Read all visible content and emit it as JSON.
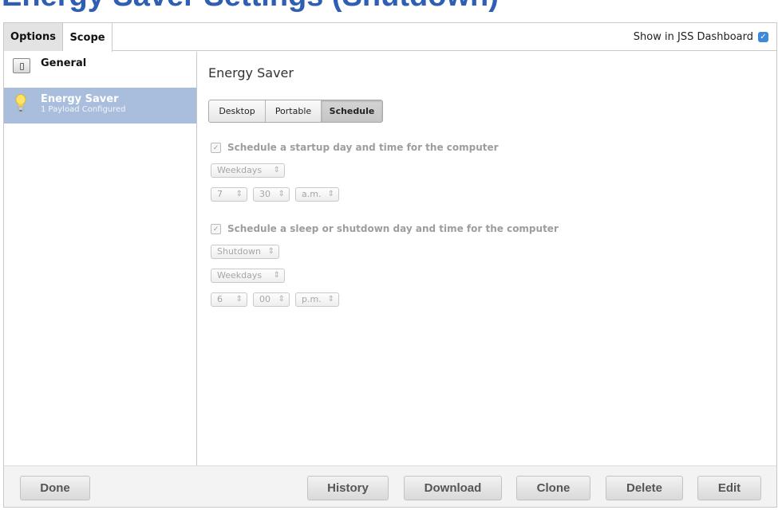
{
  "page": {
    "title": "Energy Saver Settings (Shutdown)"
  },
  "colors": {
    "accent": "#3c8ad9",
    "title": "#2f5fb3",
    "selected_row": "#a8bedc"
  },
  "tabs": {
    "options": "Options",
    "scope": "Scope"
  },
  "dashboard": {
    "label": "Show in JSS Dashboard",
    "checked": true
  },
  "sidebar": {
    "items": [
      {
        "label": "General",
        "icon": "general-switch-icon"
      },
      {
        "label": "Energy Saver",
        "sublabel": "1 Payload Configured",
        "icon": "lightbulb-icon",
        "selected": true
      }
    ]
  },
  "main": {
    "title": "Energy Saver",
    "segments": [
      "Desktop",
      "Portable",
      "Schedule"
    ],
    "active_segment": "Schedule",
    "startup": {
      "label": "Schedule a startup day and time for the computer",
      "checked": true,
      "days": "Weekdays",
      "hour": "7",
      "minute": "30",
      "ampm": "a.m."
    },
    "sleep": {
      "label": "Schedule a sleep or shutdown day and time for the computer",
      "checked": true,
      "action": "Shutdown",
      "days": "Weekdays",
      "hour": "6",
      "minute": "00",
      "ampm": "p.m."
    }
  },
  "footer": {
    "done": "Done",
    "history": "History",
    "download": "Download",
    "clone": "Clone",
    "delete": "Delete",
    "edit": "Edit"
  }
}
